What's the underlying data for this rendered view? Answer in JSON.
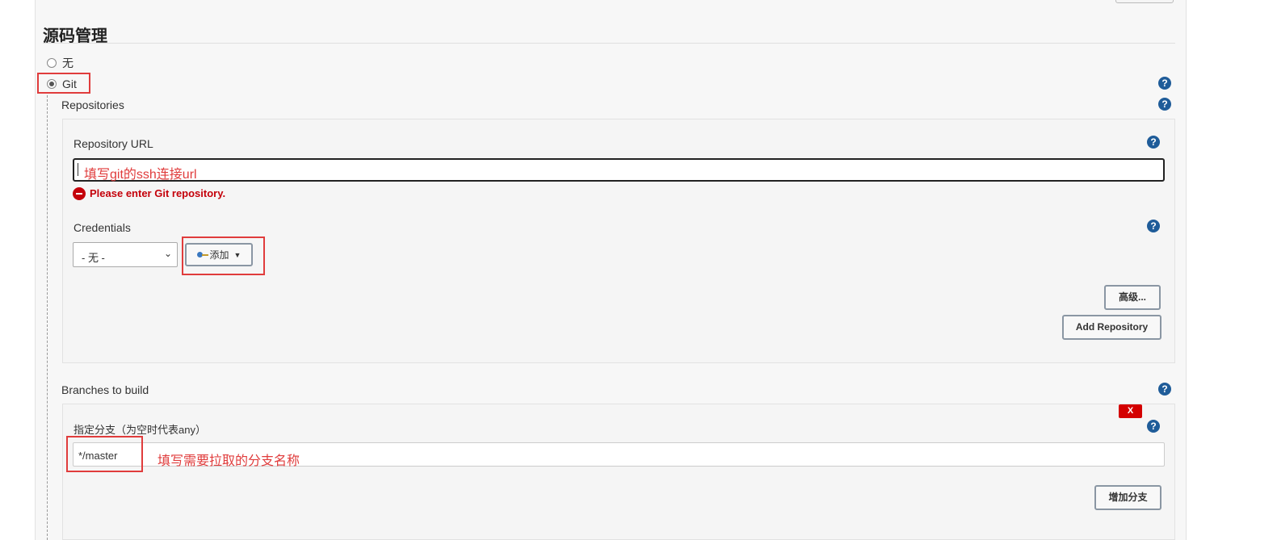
{
  "section": {
    "title": "源码管理"
  },
  "scm_options": [
    {
      "label": "无",
      "selected": false
    },
    {
      "label": "Git",
      "selected": true
    }
  ],
  "repositories": {
    "label": "Repositories",
    "url_label": "Repository URL",
    "url_value": "",
    "annotation_url": "填写git的ssh连接url",
    "error": "Please enter Git repository.",
    "credentials_label": "Credentials",
    "credentials_selected": "- 无 -",
    "add_label": "添加",
    "advanced_label": "高级...",
    "add_repository_label": "Add Repository"
  },
  "branches": {
    "label": "Branches to build",
    "spec_label": "指定分支（为空时代表any）",
    "spec_value": "*/master",
    "annotation": "填写需要拉取的分支名称",
    "delete_label": "X",
    "add_branch_label": "增加分支"
  },
  "help_icon_glyph": "?",
  "colors": {
    "annotation_red": "#e03c3c",
    "error_red": "#c4000a",
    "help_blue": "#1f5c99"
  }
}
